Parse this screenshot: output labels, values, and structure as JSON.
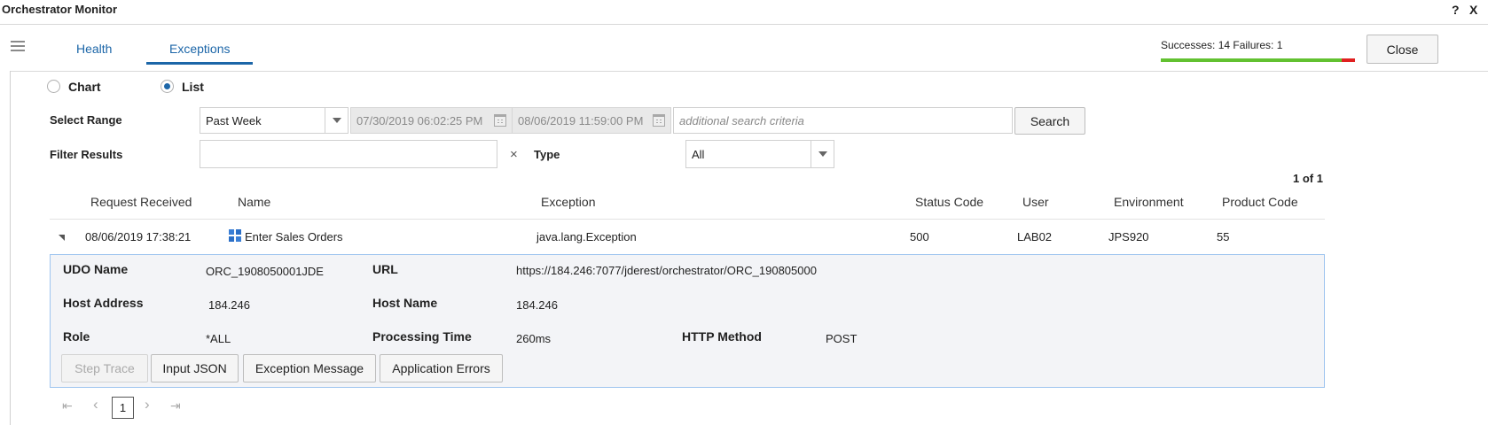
{
  "window": {
    "title": "Orchestrator Monitor",
    "help": "?",
    "close": "X"
  },
  "tabs": [
    {
      "label": "Health"
    },
    {
      "label": "Exceptions"
    }
  ],
  "stats": {
    "text": "Successes: 14 Failures: 1",
    "successes": 14,
    "failures": 1,
    "success_color": "#62c130",
    "failure_color": "#e02020"
  },
  "close_button": "Close",
  "view_mode": {
    "chart_label": "Chart",
    "list_label": "List",
    "selected": "List"
  },
  "range": {
    "label": "Select Range",
    "selected": "Past Week",
    "from": "07/30/2019 06:02:25 PM",
    "to": "08/06/2019 11:59:00 PM",
    "search_placeholder": "additional search criteria",
    "search_button": "Search"
  },
  "filter": {
    "label": "Filter Results",
    "value": "",
    "clear": "×",
    "type_label": "Type",
    "type_selected": "All"
  },
  "table": {
    "page_count": "1 of 1",
    "columns": [
      "Request Received",
      "Name",
      "Exception",
      "Status Code",
      "User",
      "Environment",
      "Product Code"
    ],
    "rows": [
      {
        "received": "08/06/2019 17:38:21",
        "name": "Enter Sales Orders",
        "exception": "java.lang.Exception",
        "status": "500",
        "user": "LAB02",
        "environment": "JPS920",
        "product_code": "55"
      }
    ]
  },
  "detail": {
    "udo_name_label": "UDO Name",
    "udo_name": "ORC_1908050001JDE",
    "url_label": "URL",
    "url": "https://184.246:7077/jderest/orchestrator/ORC_190805000",
    "host_address_label": "Host Address",
    "host_address": "184.246",
    "host_name_label": "Host Name",
    "host_name": "184.246",
    "role_label": "Role",
    "role": "*ALL",
    "processing_time_label": "Processing Time",
    "processing_time": "260ms",
    "http_method_label": "HTTP Method",
    "http_method": "POST",
    "buttons": [
      "Step Trace",
      "Input JSON",
      "Exception Message",
      "Application Errors"
    ]
  },
  "pager": {
    "first": "⇤",
    "prev": "‹",
    "page": "1",
    "next": "›",
    "last": "⇥"
  }
}
